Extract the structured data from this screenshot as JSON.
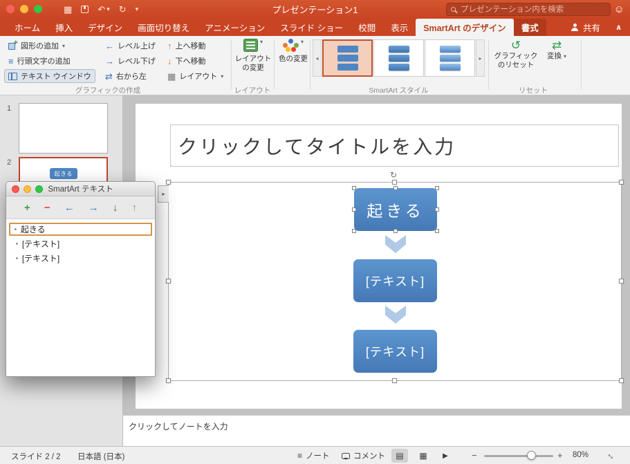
{
  "titlebar": {
    "title": "プレゼンテーション1",
    "search_placeholder": "プレゼンテーション内を検索"
  },
  "tabs": {
    "items": [
      "ホーム",
      "挿入",
      "デザイン",
      "画面切り替え",
      "アニメーション",
      "スライド ショー",
      "校閲",
      "表示",
      "SmartArt のデザイン",
      "書式"
    ],
    "active": "SmartArt のデザイン",
    "share_label": "共有"
  },
  "ribbon": {
    "create": {
      "group_label": "グラフィックの作成",
      "add_shape": "図形の追加",
      "add_bullet": "行頭文字の追加",
      "text_pane": "テキスト ウインドウ",
      "promote": "レベル上げ",
      "demote": "レベル下げ",
      "right_to_left": "右から左",
      "move_up": "上へ移動",
      "move_down": "下へ移動",
      "layout": "レイアウト"
    },
    "layout": {
      "group_label": "レイアウト",
      "change_layout_l1": "レイアウト",
      "change_layout_l2": "の変更"
    },
    "styles": {
      "group_label": "SmartArt スタイル",
      "change_colors": "色の変更"
    },
    "reset": {
      "group_label": "リセット",
      "reset_graphic_l1": "グラフィック",
      "reset_graphic_l2": "のリセット",
      "convert": "変換"
    }
  },
  "slides_panel": {
    "slide1_number": "1",
    "slide2_number": "2",
    "thumb_node_label": "起きる"
  },
  "text_pane_window": {
    "title": "SmartArt テキスト",
    "items": [
      "起きる",
      "[テキスト]",
      "[テキスト]"
    ]
  },
  "slide": {
    "title_placeholder": "クリックしてタイトルを入力",
    "nodes": [
      "起きる",
      "[テキスト]",
      "[テキスト]"
    ]
  },
  "notes": {
    "placeholder": "クリックしてノートを入力"
  },
  "statusbar": {
    "slide_counter": "スライド 2 / 2",
    "language": "日本語 (日本)",
    "notes_label": "ノート",
    "comments_label": "コメント",
    "zoom_level": "80%"
  },
  "icons": {
    "tiles": "▦",
    "undo": "↶",
    "redo": "↻",
    "caret": "▾",
    "smiley": "☺",
    "collapse": "∧",
    "promote": "←",
    "demote": "→",
    "right_to_left": "⇄",
    "move_up": "↑",
    "move_down": "↓",
    "layout": "▦",
    "bullets": "≡",
    "gallery_left": "◂",
    "gallery_right": "▸",
    "reset": "↺",
    "convert": "⇄",
    "pane_toggle": "▸",
    "rotate": "↻",
    "plus": "+",
    "minus": "−",
    "arrow_left": "←",
    "arrow_right": "→",
    "arrow_down": "↓",
    "arrow_up": "↑",
    "bullet": "▪",
    "notes": "≡",
    "view_normal": "▤",
    "view_sorter": "▦",
    "view_slideshow": "▶",
    "zoom_out": "−",
    "zoom_in": "+",
    "expand": "↔"
  },
  "colors": {
    "titlebar_red": "#C94423",
    "active_tab_text": "#B8451F",
    "smartart_blue": "#4E86C4",
    "selection_orange": "#D0954A",
    "selected_thumb_border": "#C2432A"
  }
}
